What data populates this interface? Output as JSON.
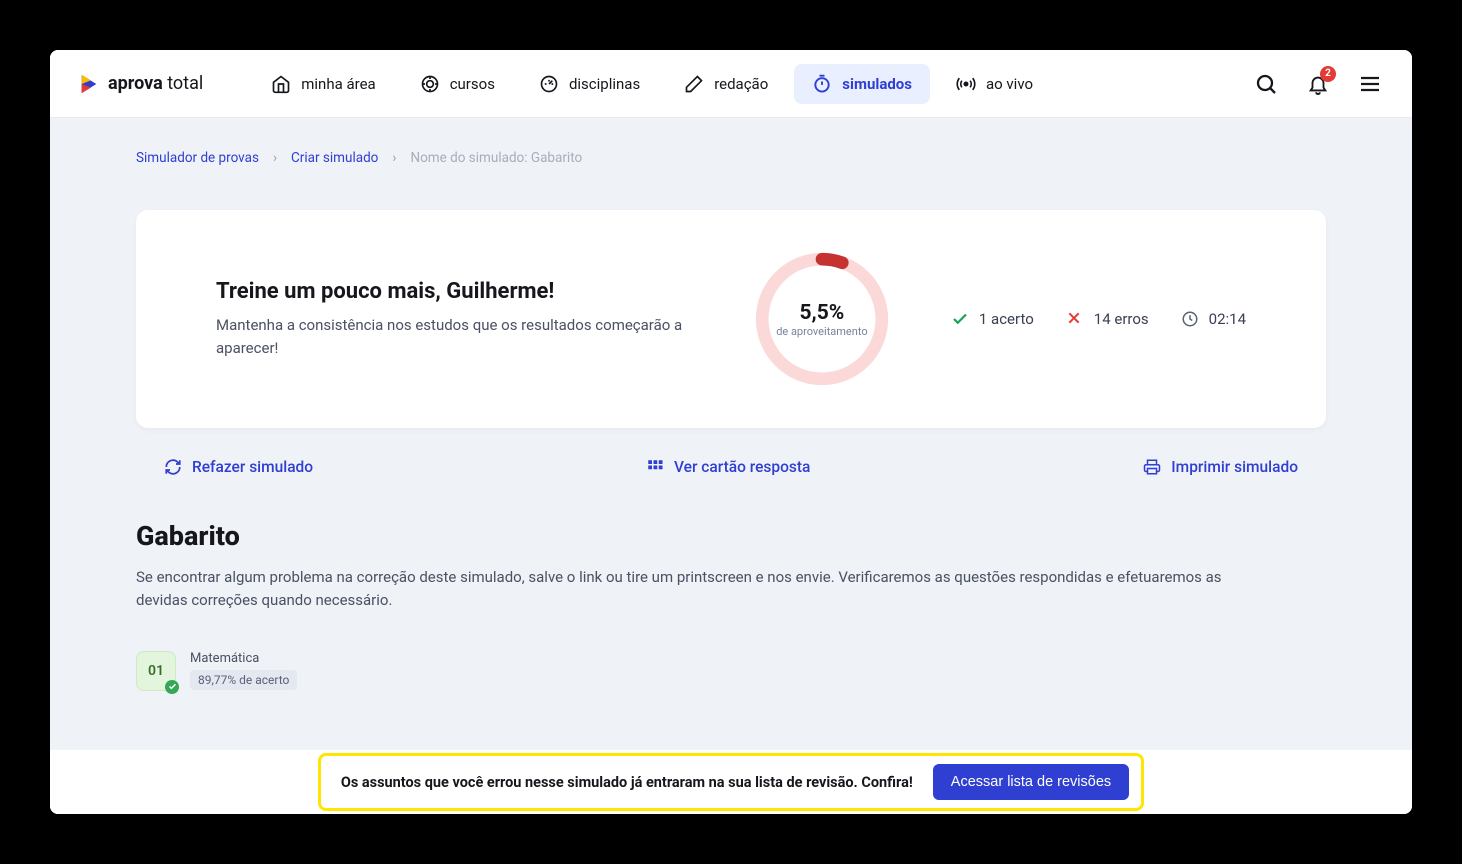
{
  "brand": {
    "bold": "aprova",
    "light": " total"
  },
  "nav": {
    "area": "minha área",
    "cursos": "cursos",
    "disciplinas": "disciplinas",
    "redacao": "redação",
    "simulados": "simulados",
    "aovivo": "ao vivo"
  },
  "notif_count": "2",
  "breadcrumb": {
    "a": "Simulador de provas",
    "b": "Criar simulado",
    "current": "Nome do simulado: Gabarito"
  },
  "result": {
    "title": "Treine um pouco mais,  Guilherme!",
    "subtitle": "Mantenha a consistência nos estudos que os resultados começarão a aparecer!",
    "pct": "5,5%",
    "pct_label": "de aproveitamento",
    "correct": "1 acerto",
    "wrong": "14 erros",
    "time": "02:14"
  },
  "chart_data": {
    "type": "pie",
    "title": "Aproveitamento",
    "values": [
      5.5,
      94.5
    ],
    "categories": [
      "acerto",
      "erro"
    ]
  },
  "actions": {
    "redo": "Refazer simulado",
    "card": "Ver cartão resposta",
    "print": "Imprimir simulado"
  },
  "gabarito": {
    "title": "Gabarito",
    "desc": "Se encontrar algum problema na correção deste simulado, salve o link ou tire um printscreen e nos envie. Verificaremos as questões respondidas e efetuaremos as devidas correções quando necessário."
  },
  "question": {
    "num": "01",
    "subject": "Matemática",
    "accuracy": "89,77% de acerto"
  },
  "bottombar": {
    "text": "Os assuntos que você errou nesse simulado já entraram na sua lista de revisão. Confira!",
    "button": "Acessar lista de revisões"
  }
}
